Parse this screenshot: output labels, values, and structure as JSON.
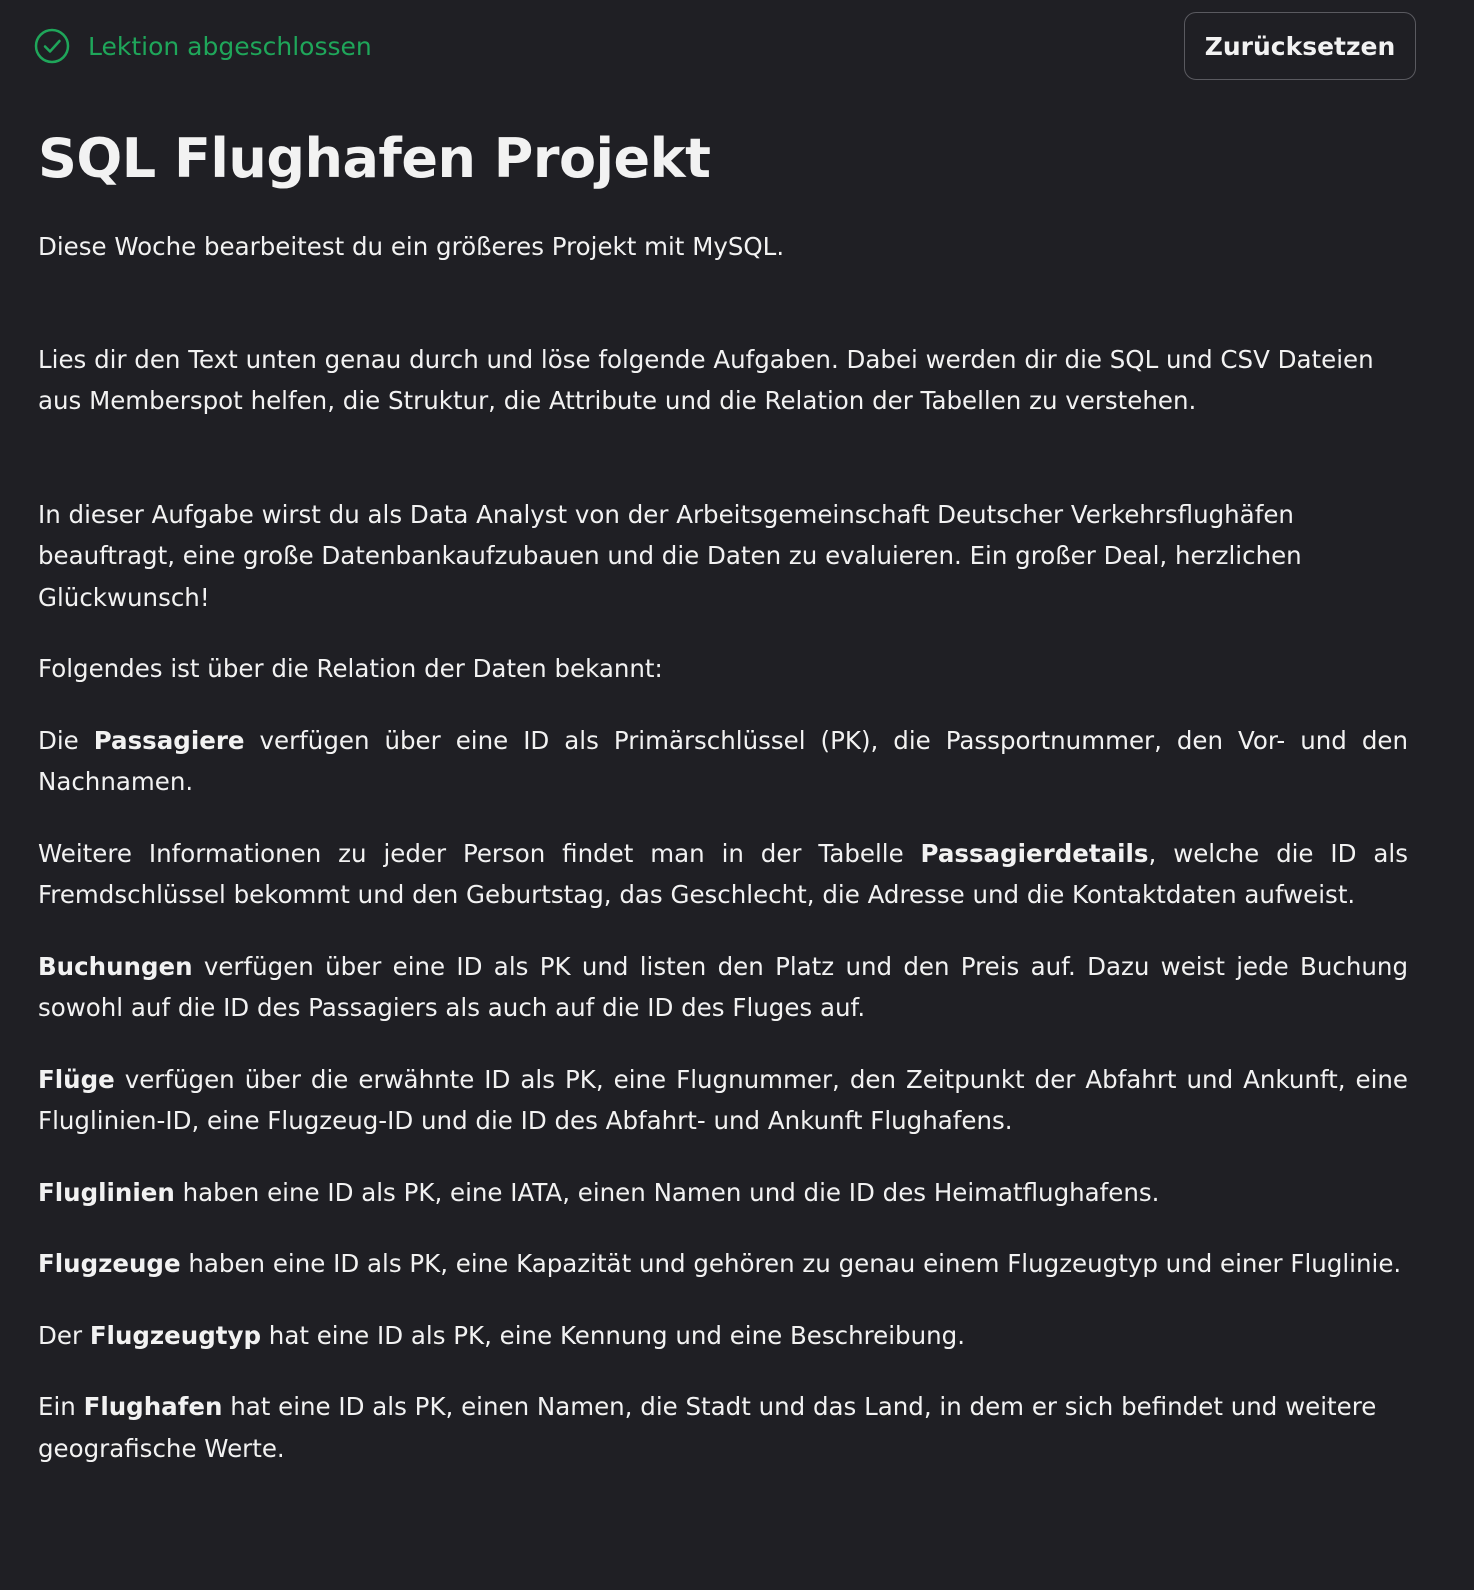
{
  "header": {
    "status_label": "Lektion abgeschlossen",
    "reset_label": "Zurücksetzen"
  },
  "colors": {
    "background": "#1f1f24",
    "text": "#f2f2f2",
    "success": "#1fa65a",
    "button_border": "#5a5a60"
  },
  "icons": {
    "status": "check-circle-icon"
  },
  "lesson": {
    "title": "SQL Flughafen Projekt",
    "intro": "Diese Woche bearbeitest du ein größeres Projekt mit MySQL.",
    "task": "Lies dir den Text unten genau durch und löse folgende Aufgaben. Dabei werden dir die SQL und CSV Dateien aus Memberspot helfen, die Struktur, die Attribute und die Relation der Tabellen zu verstehen.",
    "scenario": "In dieser Aufgabe wirst du als Data Analyst von der Arbeitsgemeinschaft Deutscher Verkehrsflughäfen beauftragt, eine große Datenbankaufzubauen und die Daten zu evaluieren. Ein großer Deal, herzlichen Glückwunsch!",
    "relations_intro": "Folgendes ist über die Relation der Daten bekannt:",
    "passagiere": {
      "prefix": "Die ",
      "bold": "Passagiere",
      "rest": " verfügen über eine ID als Primärschlüssel (PK), die Passportnummer, den Vor- und den Nachnamen."
    },
    "passagierdetails": {
      "prefix": "Weitere Informationen zu jeder Person findet man in der Tabelle ",
      "bold": "Passagierdetails",
      "rest": ", welche die ID als Fremdschlüssel bekommt und den Geburtstag, das Geschlecht, die Adresse und die Kontaktdaten aufweist."
    },
    "buchungen": {
      "bold": "Buchungen",
      "rest": " verfügen über eine ID als PK und listen den Platz und den Preis auf. Dazu weist jede Buchung sowohl auf die ID des Passagiers als auch auf die ID des Fluges auf."
    },
    "fluege": {
      "bold": "Flüge",
      "rest": " verfügen über die erwähnte ID als PK, eine Flugnummer, den Zeitpunkt der Abfahrt und Ankunft, eine Fluglinien-ID, eine Flugzeug-ID und die ID des Abfahrt- und Ankunft Flughafens."
    },
    "fluglinien": {
      "bold": "Fluglinien",
      "rest": " haben eine ID als PK, eine IATA, einen Namen und die ID des Heimatflughafens."
    },
    "flugzeuge": {
      "bold": "Flugzeuge",
      "rest": " haben eine ID als PK, eine Kapazität und gehören zu genau einem Flugzeugtyp und einer Fluglinie."
    },
    "flugzeugtyp": {
      "prefix": "Der ",
      "bold": "Flugzeugtyp",
      "rest": " hat eine ID als PK, eine Kennung und eine Beschreibung."
    },
    "flughafen": {
      "prefix": "Ein ",
      "bold": "Flughafen",
      "rest": " hat eine ID als PK, einen Namen, die Stadt und das Land, in dem er sich befindet und weitere geografische Werte."
    }
  }
}
